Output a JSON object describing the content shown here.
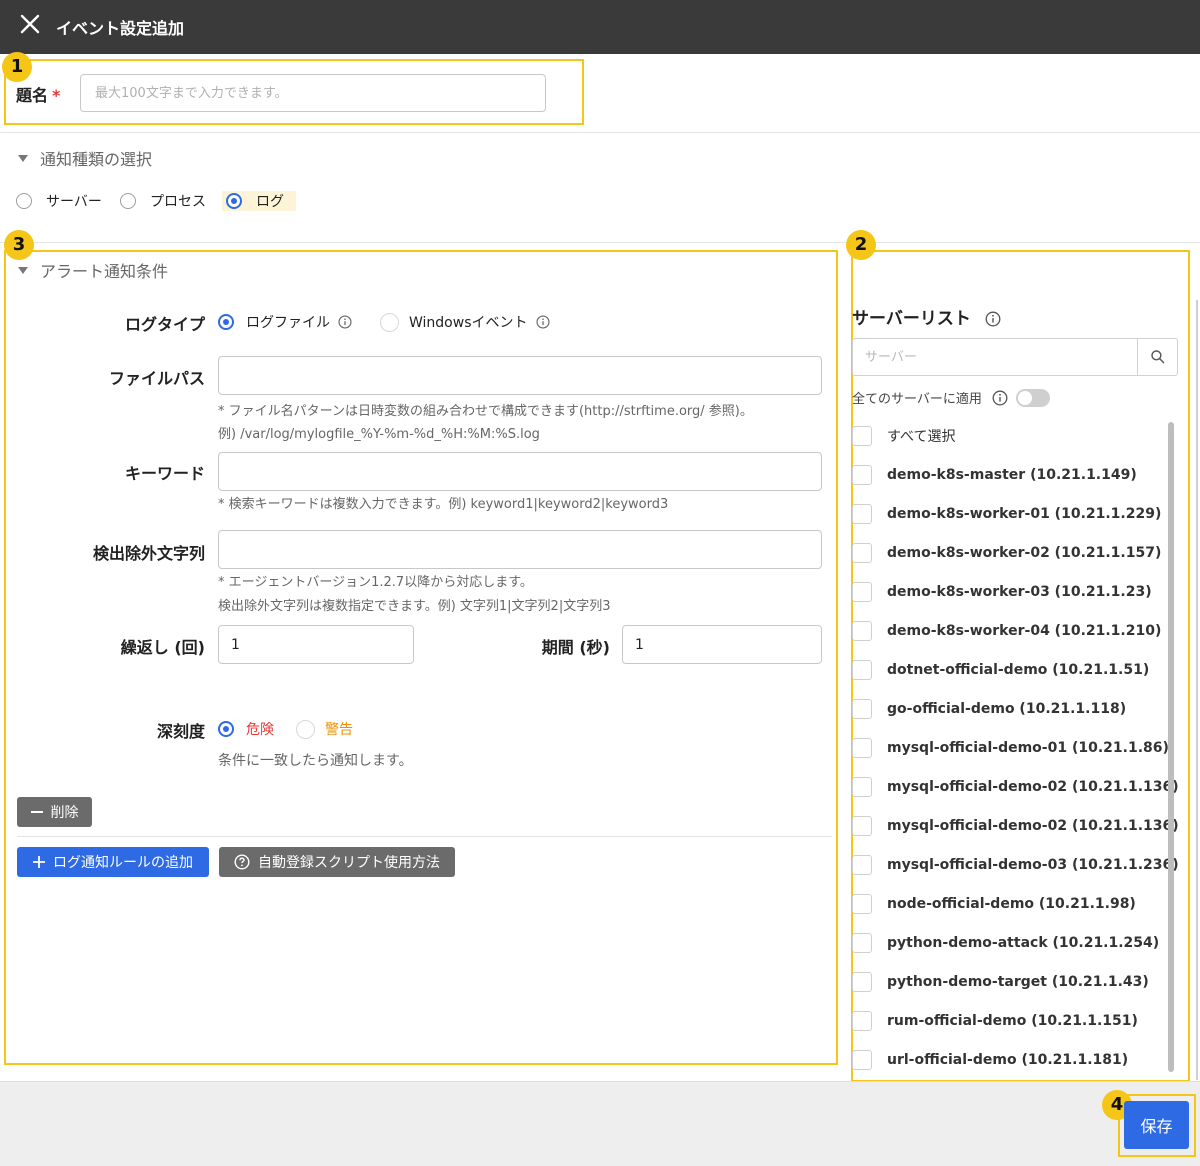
{
  "window": {
    "title": "イベント設定追加",
    "close_icon": "close-icon"
  },
  "annotations": [
    "1",
    "2",
    "3",
    "4"
  ],
  "subject": {
    "label": "題名",
    "required_mark": "*",
    "placeholder": "最大100文字まで入力できます。",
    "value": ""
  },
  "notification_type": {
    "section_title": "通知種類の選択",
    "options": [
      {
        "label": "サーバー",
        "selected": false
      },
      {
        "label": "プロセス",
        "selected": false
      },
      {
        "label": "ログ",
        "selected": true
      }
    ]
  },
  "alert_conditions": {
    "section_title": "アラート通知条件",
    "log_type": {
      "label": "ログタイプ",
      "options": [
        {
          "label": "ログファイル",
          "selected": true
        },
        {
          "label": "Windowsイベント",
          "selected": false
        }
      ]
    },
    "file_path": {
      "label": "ファイルパス",
      "value": "",
      "hint_line1": "* ファイル名パターンは日時変数の組み合わせで構成できます(http://strftime.org/ 参照)。",
      "hint_line2": "例) /var/log/mylogfile_%Y-%m-%d_%H:%M:%S.log"
    },
    "keyword": {
      "label": "キーワード",
      "value": "",
      "hint": "* 検索キーワードは複数入力できます。例) keyword1|keyword2|keyword3"
    },
    "exclude": {
      "label": "検出除外文字列",
      "value": "",
      "hint_line1": "* エージェントバージョン1.2.7以降から対応します。",
      "hint_line2": "検出除外文字列は複数指定できます。例) 文字列1|文字列2|文字列3"
    },
    "repeat": {
      "label": "繰返し (回)",
      "value": "1"
    },
    "period": {
      "label": "期間 (秒)",
      "value": "1"
    },
    "severity": {
      "label": "深刻度",
      "options": [
        {
          "label": "危険",
          "selected": true,
          "color": "#e53935"
        },
        {
          "label": "警告",
          "selected": false,
          "color": "#f09000"
        }
      ],
      "hint": "条件に一致したら通知します。"
    },
    "delete_button": "削除",
    "add_rule_button": "ログ通知ルールの追加",
    "help_button": "自動登録スクリプト使用方法"
  },
  "server_list": {
    "title": "サーバーリスト",
    "search_placeholder": "サーバー",
    "apply_all_label": "全てのサーバーに適用",
    "apply_all_on": false,
    "select_all_label": "すべて選択",
    "servers": [
      "demo-k8s-master (10.21.1.149)",
      "demo-k8s-worker-01 (10.21.1.229)",
      "demo-k8s-worker-02 (10.21.1.157)",
      "demo-k8s-worker-03 (10.21.1.23)",
      "demo-k8s-worker-04 (10.21.1.210)",
      "dotnet-official-demo (10.21.1.51)",
      "go-official-demo (10.21.1.118)",
      "mysql-official-demo-01 (10.21.1.86)",
      "mysql-official-demo-02 (10.21.1.136)",
      "mysql-official-demo-02 (10.21.1.136)",
      "mysql-official-demo-03 (10.21.1.236)",
      "node-official-demo (10.21.1.98)",
      "python-demo-attack (10.21.1.254)",
      "python-demo-target (10.21.1.43)",
      "rum-official-demo (10.21.1.151)",
      "url-official-demo (10.21.1.181)"
    ]
  },
  "save_button": "保存",
  "colors": {
    "accent": "#2d6ae3",
    "highlight": "#f5c518",
    "titlebar": "#3a3a3a",
    "danger": "#e53935",
    "warning": "#f09000"
  }
}
